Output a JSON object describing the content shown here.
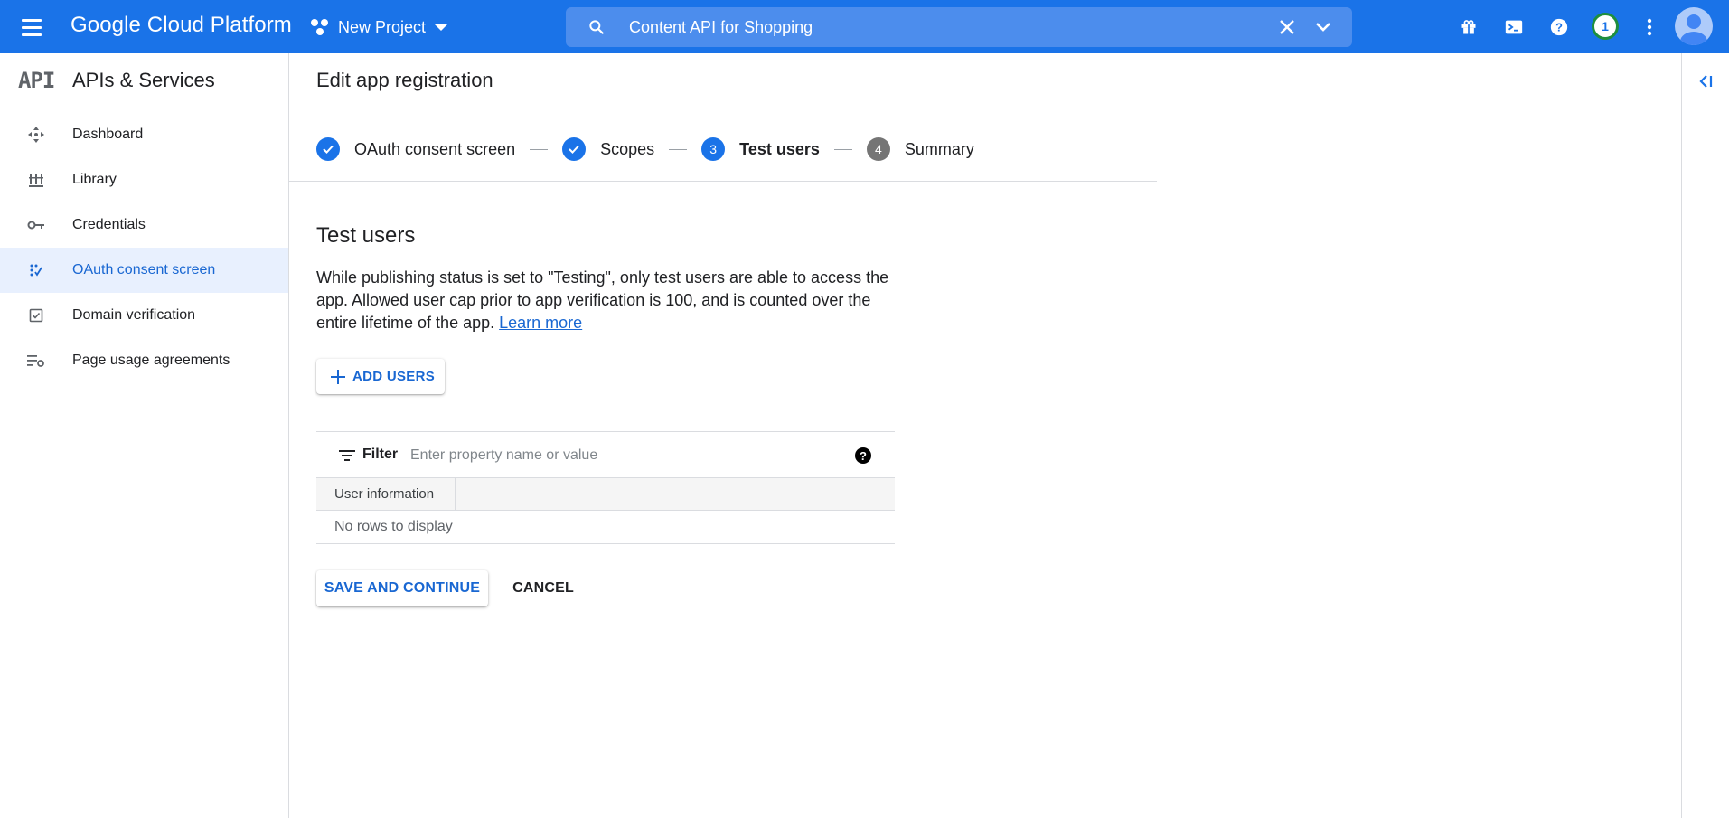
{
  "topbar": {
    "brand": "Google Cloud Platform",
    "project": "New Project",
    "search_value": "Content API for Shopping",
    "notification_count": "1",
    "brand_color": "#1a73e8"
  },
  "sidebar": {
    "logo": "API",
    "title": "APIs & Services",
    "items": [
      {
        "label": "Dashboard",
        "icon": "dashboard-icon"
      },
      {
        "label": "Library",
        "icon": "library-icon"
      },
      {
        "label": "Credentials",
        "icon": "key-icon"
      },
      {
        "label": "OAuth consent screen",
        "icon": "consent-icon",
        "active": true
      },
      {
        "label": "Domain verification",
        "icon": "checkbox-icon"
      },
      {
        "label": "Page usage agreements",
        "icon": "settings-list-icon"
      }
    ]
  },
  "main": {
    "page_title": "Edit app registration",
    "steps": [
      {
        "label": "OAuth consent screen",
        "state": "done"
      },
      {
        "label": "Scopes",
        "state": "done"
      },
      {
        "label": "Test users",
        "number": "3",
        "state": "current"
      },
      {
        "label": "Summary",
        "number": "4",
        "state": "pending"
      }
    ],
    "section_title": "Test users",
    "description": "While publishing status is set to \"Testing\", only test users are able to access the app. Allowed user cap prior to app verification is 100, and is counted over the entire lifetime of the app.",
    "learn_more": "Learn more",
    "add_users_label": "ADD USERS",
    "filter": {
      "label": "Filter",
      "placeholder": "Enter property name or value",
      "help": "?"
    },
    "table": {
      "columns": [
        "User information"
      ],
      "empty_message": "No rows to display"
    },
    "save_label": "SAVE AND CONTINUE",
    "cancel_label": "CANCEL"
  }
}
